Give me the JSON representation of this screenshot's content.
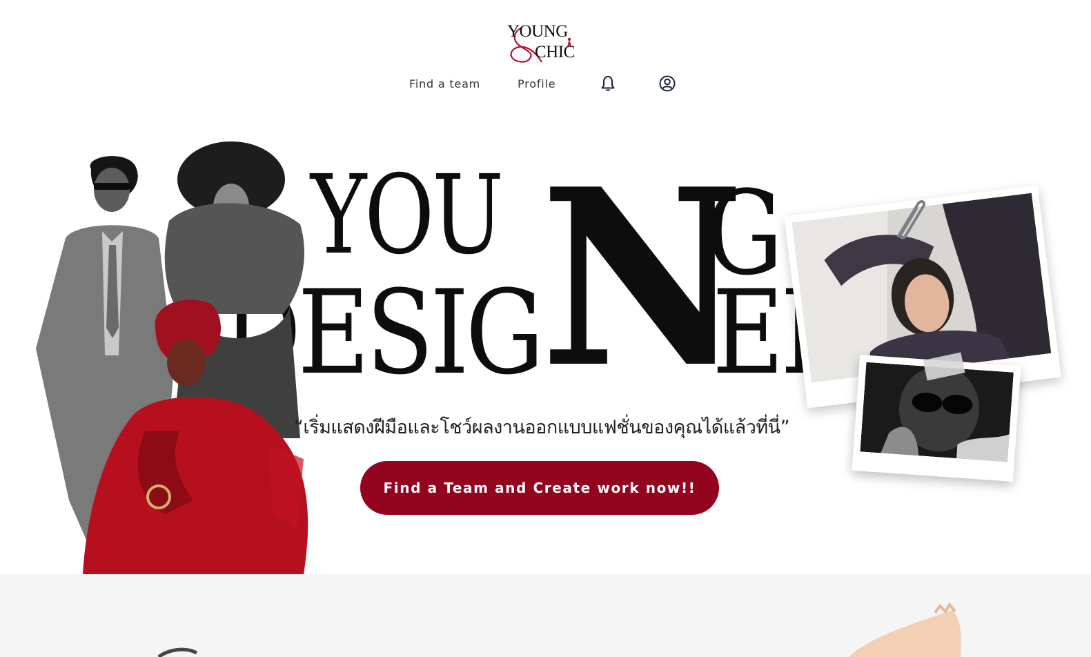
{
  "logo": {
    "line1": "YOUNG",
    "line2": "CHIC"
  },
  "nav": {
    "find_team": "Find a team",
    "profile": "Profile",
    "notification_icon": "bell-icon",
    "account_icon": "user-circle-icon"
  },
  "hero": {
    "title_young": "YOU",
    "title_n": "N",
    "title_g": "G",
    "title_desig": "DESIG",
    "title_er": "ER",
    "tagline": "“เริ่มแสดงฝีมือและโชว์ผลงานออกแบบแฟชั่นของคุณได้แล้วที่นี่”",
    "cta_label": "Find a Team and Create work now!!"
  },
  "colors": {
    "brand": "#93041f",
    "text": "#0d0d0d",
    "lower_bg": "#f5f5f5"
  }
}
